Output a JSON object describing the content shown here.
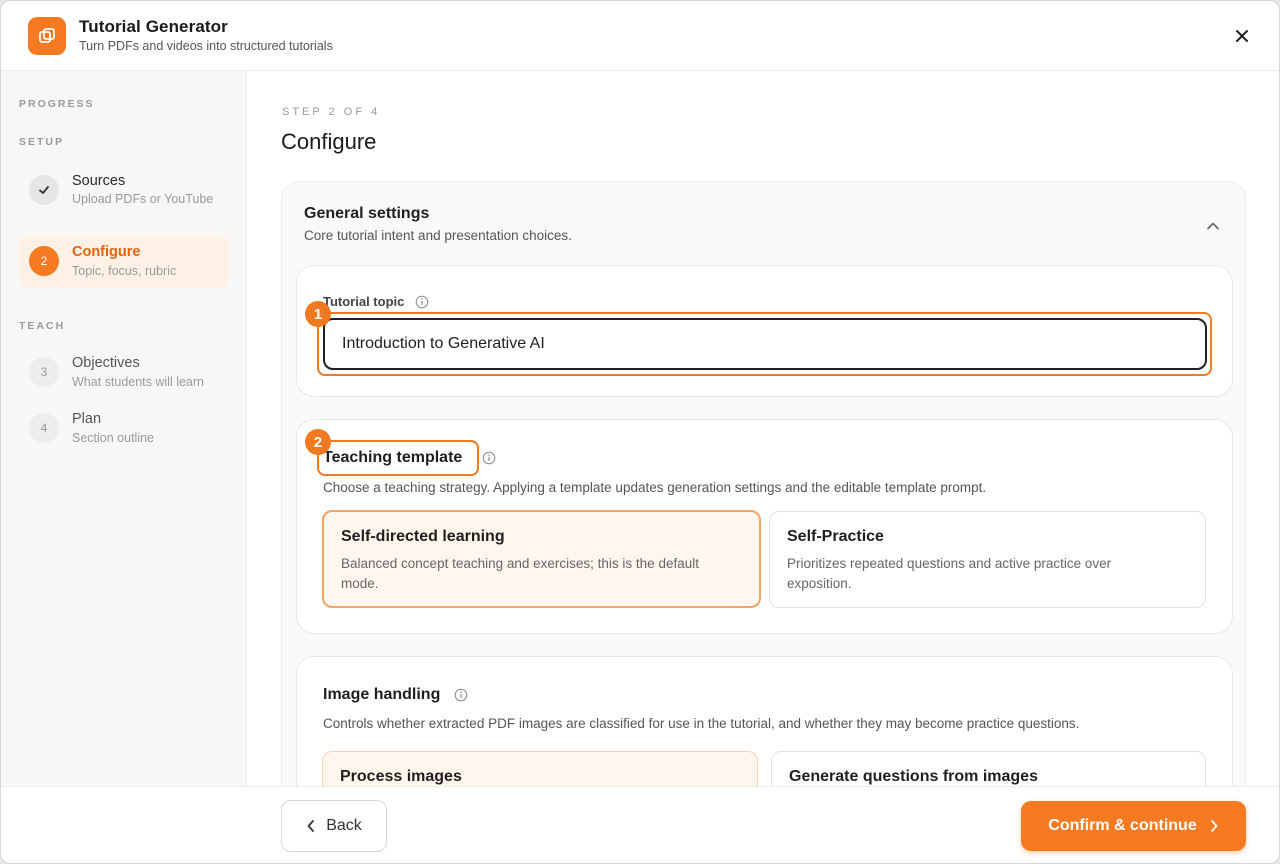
{
  "app": {
    "title": "Tutorial Generator",
    "subtitle": "Turn PDFs and videos into structured tutorials",
    "accent_color": "#f57a21"
  },
  "sidebar": {
    "progress_label": "PROGRESS",
    "setup_label": "SETUP",
    "teach_label": "TEACH",
    "steps": [
      {
        "marker": "check-icon",
        "label": "Sources",
        "description": "Upload PDFs or YouTube",
        "state": "done"
      },
      {
        "marker": "2",
        "label": "Configure",
        "description": "Topic, focus, rubric",
        "state": "current"
      },
      {
        "marker": "3",
        "label": "Objectives",
        "description": "What students will learn",
        "state": "upcoming"
      },
      {
        "marker": "4",
        "label": "Plan",
        "description": "Section outline",
        "state": "upcoming"
      }
    ]
  },
  "main": {
    "step_kicker": "STEP 2 OF 4",
    "title": "Configure",
    "general": {
      "title": "General settings",
      "description": "Core tutorial intent and presentation choices."
    },
    "topic": {
      "label": "Tutorial topic",
      "value": "Introduction to Generative AI",
      "annotation": "1"
    },
    "template": {
      "title": "Teaching template",
      "annotation": "2",
      "description": "Choose a teaching strategy. Applying a template updates generation settings and the editable template prompt.",
      "options": [
        {
          "title": "Self-directed learning",
          "description": "Balanced concept teaching and exercises; this is the default mode.",
          "selected": true
        },
        {
          "title": "Self-Practice",
          "description": "Prioritizes repeated questions and active practice over exposition.",
          "selected": false
        }
      ]
    },
    "images": {
      "title": "Image handling",
      "description": "Controls whether extracted PDF images are classified for use in the tutorial, and whether they may become practice questions.",
      "options": [
        {
          "title": "Process images",
          "selected": true
        },
        {
          "title": "Generate questions from images",
          "selected": false
        }
      ]
    }
  },
  "footer": {
    "back_label": "Back",
    "confirm_label": "Confirm & continue"
  }
}
